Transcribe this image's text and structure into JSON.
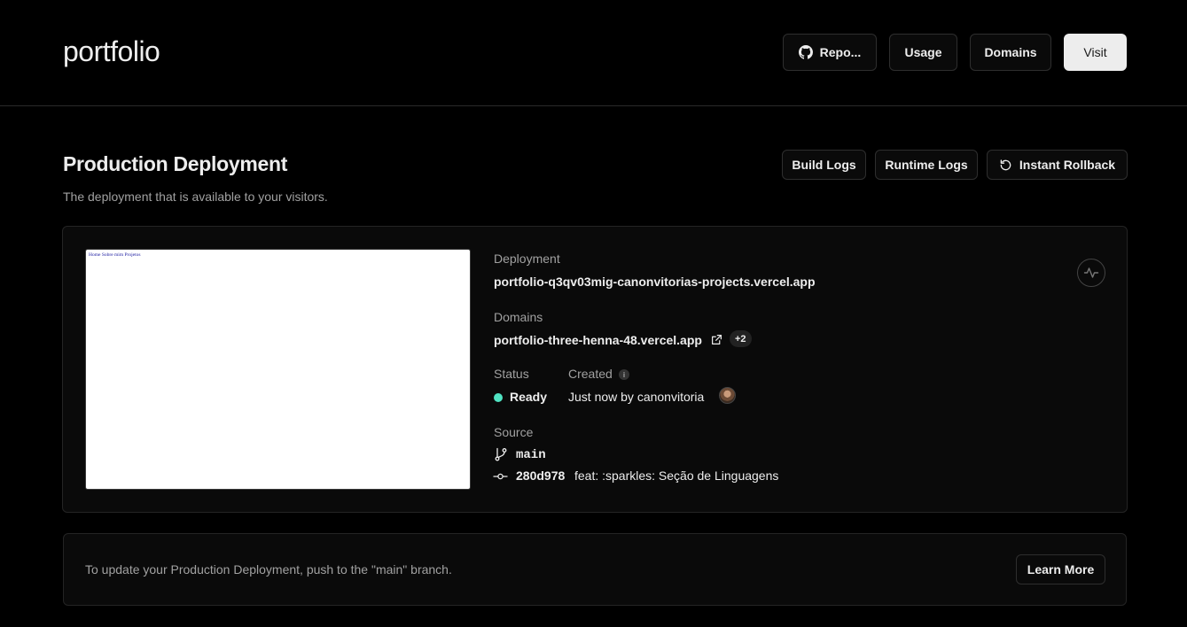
{
  "header": {
    "project_name": "portfolio",
    "repo_label": "Repo...",
    "usage_label": "Usage",
    "domains_label": "Domains",
    "visit_label": "Visit"
  },
  "production": {
    "title": "Production Deployment",
    "subtitle": "The deployment that is available to your visitors.",
    "build_logs_label": "Build Logs",
    "runtime_logs_label": "Runtime Logs",
    "rollback_label": "Instant Rollback"
  },
  "preview": {
    "nav_text": "Home Sobre mim Projetos"
  },
  "deployment": {
    "label": "Deployment",
    "url": "portfolio-q3qv03mig-canonvitorias-projects.vercel.app",
    "domains_label": "Domains",
    "domain": "portfolio-three-henna-48.vercel.app",
    "domains_extra": "+2",
    "status_label": "Status",
    "status_value": "Ready",
    "status_color": "#50e3c2",
    "created_label": "Created",
    "created_value": "Just now by canonvitoria",
    "source_label": "Source",
    "branch": "main",
    "commit_hash": "280d978",
    "commit_message": "feat: :sparkles: Seção de Linguagens"
  },
  "notice": {
    "text": "To update your Production Deployment, push to the \"main\" branch.",
    "learn_more_label": "Learn More"
  },
  "icons": {
    "repo": "github-icon",
    "rollback": "rollback-icon",
    "external": "external-link-icon",
    "branch": "git-branch-icon",
    "commit": "git-commit-icon",
    "activity": "activity-icon",
    "info": "info-icon"
  }
}
